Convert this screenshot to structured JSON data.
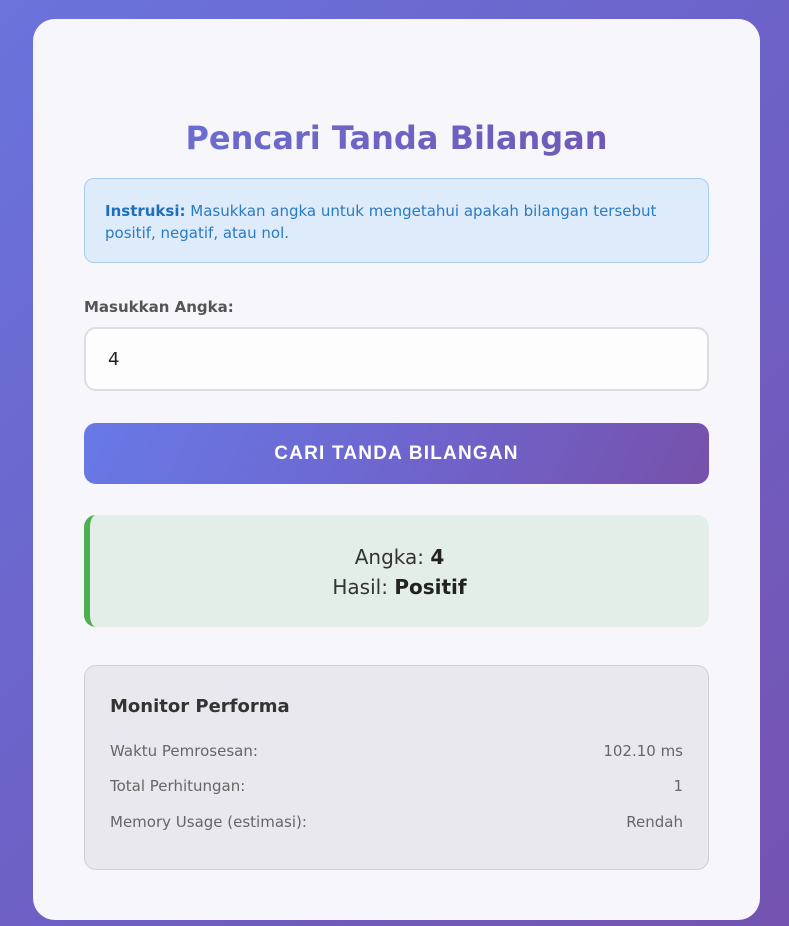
{
  "title": "Pencari Tanda Bilangan",
  "instructions": {
    "label": "Instruksi:",
    "text": " Masukkan angka untuk mengetahui apakah bilangan tersebut positif, negatif, atau nol."
  },
  "input": {
    "label": "Masukkan Angka:",
    "value": "4"
  },
  "search_button": {
    "label": "CARI TANDA BILANGAN"
  },
  "result": {
    "number_label": "Angka: ",
    "number_value": "4",
    "result_label": "Hasil: ",
    "result_value": "Positif"
  },
  "monitor": {
    "title": "Monitor Performa",
    "rows": [
      {
        "label": "Waktu Pemrosesan:",
        "value": "102.10 ms"
      },
      {
        "label": "Total Perhitungan:",
        "value": "1"
      },
      {
        "label": "Memory Usage (estimasi):",
        "value": "Rendah"
      }
    ]
  },
  "colors": {
    "accent_gradient_start": "#6874d8",
    "accent_gradient_end": "#7352ad",
    "success": "#4caf50",
    "info": "#2a7ac4"
  }
}
